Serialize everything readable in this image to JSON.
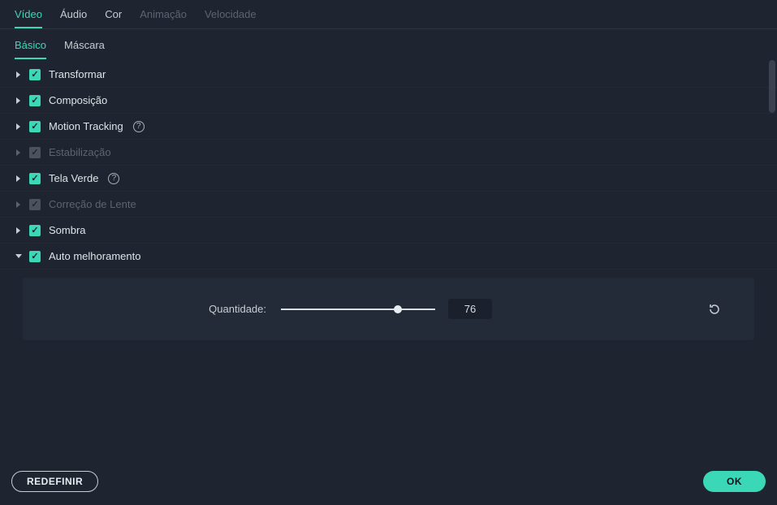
{
  "topTabs": [
    {
      "label": "Vídeo",
      "state": "active"
    },
    {
      "label": "Áudio",
      "state": "normal"
    },
    {
      "label": "Cor",
      "state": "normal"
    },
    {
      "label": "Animação",
      "state": "disabled"
    },
    {
      "label": "Velocidade",
      "state": "disabled"
    }
  ],
  "subTabs": [
    {
      "label": "Básico",
      "state": "active"
    },
    {
      "label": "Máscara",
      "state": "normal"
    }
  ],
  "sections": [
    {
      "label": "Transformar",
      "checked": true,
      "disabled": false,
      "expanded": false,
      "help": false
    },
    {
      "label": "Composição",
      "checked": true,
      "disabled": false,
      "expanded": false,
      "help": false
    },
    {
      "label": "Motion Tracking",
      "checked": true,
      "disabled": false,
      "expanded": false,
      "help": true
    },
    {
      "label": "Estabilização",
      "checked": true,
      "disabled": true,
      "expanded": false,
      "help": false
    },
    {
      "label": "Tela Verde",
      "checked": true,
      "disabled": false,
      "expanded": false,
      "help": true
    },
    {
      "label": "Correção de Lente",
      "checked": true,
      "disabled": true,
      "expanded": false,
      "help": false
    },
    {
      "label": "Sombra",
      "checked": true,
      "disabled": false,
      "expanded": false,
      "help": false
    },
    {
      "label": "Auto melhoramento",
      "checked": true,
      "disabled": false,
      "expanded": true,
      "help": false
    }
  ],
  "autoEnhance": {
    "label": "Quantidade:",
    "value": "76"
  },
  "footer": {
    "resetLabel": "REDEFINIR",
    "okLabel": "OK"
  }
}
